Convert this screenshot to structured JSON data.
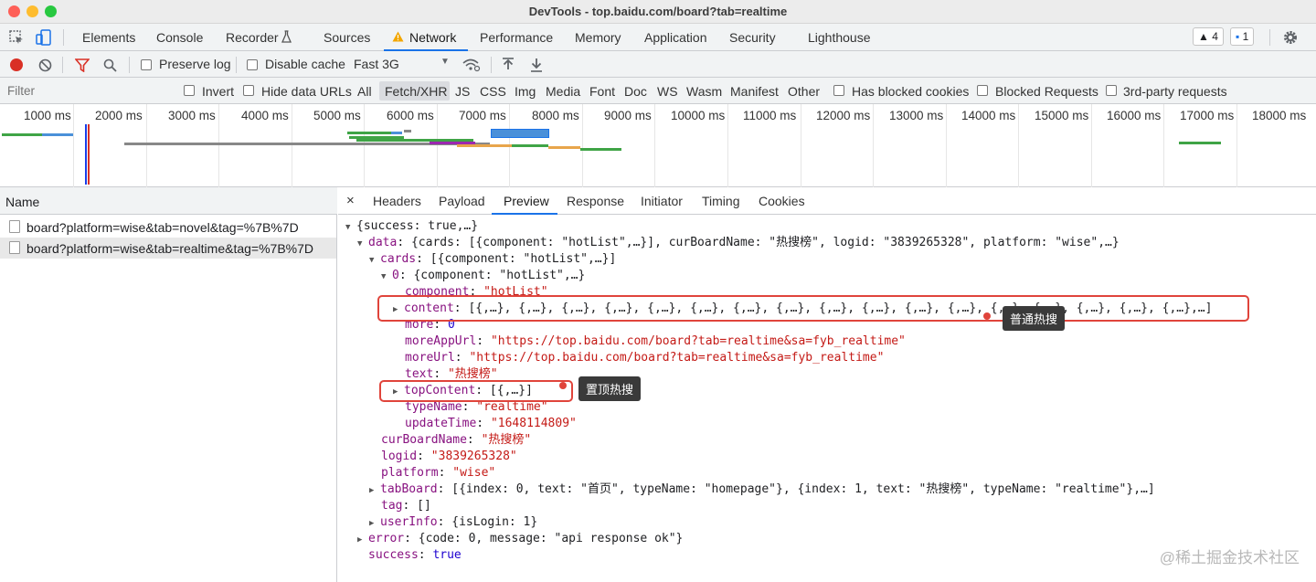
{
  "window": {
    "title": "DevTools - top.baidu.com/board?tab=realtime"
  },
  "main_tabs": [
    "Elements",
    "Console",
    "Recorder",
    "Sources",
    "Network",
    "Performance",
    "Memory",
    "Application",
    "Security",
    "Lighthouse"
  ],
  "badges": {
    "warnings": "4",
    "messages": "1"
  },
  "toolbar": {
    "preserve_log": "Preserve log",
    "disable_cache": "Disable cache",
    "throttle": "Fast 3G"
  },
  "filterbar": {
    "placeholder": "Filter",
    "invert": "Invert",
    "hide_data_urls": "Hide data URLs",
    "types": [
      "All",
      "Fetch/XHR",
      "JS",
      "CSS",
      "Img",
      "Media",
      "Font",
      "Doc",
      "WS",
      "Wasm",
      "Manifest",
      "Other"
    ],
    "selected_type": "Fetch/XHR",
    "blocked_cookies": "Has blocked cookies",
    "blocked_requests": "Blocked Requests",
    "third_party": "3rd-party requests"
  },
  "timeline": {
    "ticks": [
      "1000 ms",
      "2000 ms",
      "3000 ms",
      "4000 ms",
      "5000 ms",
      "6000 ms",
      "7000 ms",
      "8000 ms",
      "9000 ms",
      "10000 ms",
      "11000 ms",
      "12000 ms",
      "13000 ms",
      "14000 ms",
      "15000 ms",
      "16000 ms",
      "17000 ms",
      "18000 ms"
    ]
  },
  "requests": {
    "header": "Name",
    "items": [
      "board?platform=wise&tab=novel&tag=%7B%7D",
      "board?platform=wise&tab=realtime&tag=%7B%7D"
    ],
    "selected_index": 1
  },
  "detail_tabs": [
    "Headers",
    "Payload",
    "Preview",
    "Response",
    "Initiator",
    "Timing",
    "Cookies"
  ],
  "detail_close": "×",
  "preview": {
    "l1": "{success: true,…}",
    "l2_key": "data",
    "l2_val": ": {cards: [{component: \"hotList\",…}], curBoardName: \"热搜榜\", logid: \"3839265328\", platform: \"wise\",…}",
    "l3_key": "cards",
    "l3_val": ": [{component: \"hotList\",…}]",
    "l4_key": "0",
    "l4_val": ": {component: \"hotList\",…}",
    "l5_key": "component",
    "l5_val": "\"hotList\"",
    "l6_key": "content",
    "l6_val": ": [{,…}, {,…}, {,…}, {,…}, {,…}, {,…}, {,…}, {,…}, {,…}, {,…}, {,…}, {,…}, {,…}, {,…}, {,…}, {,…}, {,…},…]",
    "l7_key": "more",
    "l7_val": "0",
    "l8_key": "moreAppUrl",
    "l8_val": "\"https://top.baidu.com/board?tab=realtime&sa=fyb_realtime\"",
    "l9_key": "moreUrl",
    "l9_val": "\"https://top.baidu.com/board?tab=realtime&sa=fyb_realtime\"",
    "l10_key": "text",
    "l10_val": "\"热搜榜\"",
    "l11_key": "topContent",
    "l11_val": ": [{,…}]",
    "l12_key": "typeName",
    "l12_val": "\"realtime\"",
    "l13_key": "updateTime",
    "l13_val": "\"1648114809\"",
    "l14_key": "curBoardName",
    "l14_val": "\"热搜榜\"",
    "l15_key": "logid",
    "l15_val": "\"3839265328\"",
    "l16_key": "platform",
    "l16_val": "\"wise\"",
    "l17_key": "tabBoard",
    "l17_val": ": [{index: 0, text: \"首页\", typeName: \"homepage\"}, {index: 1, text: \"热搜榜\", typeName: \"realtime\"},…]",
    "l18_key": "tag",
    "l18_val": ": []",
    "l19_key": "userInfo",
    "l19_val": ": {isLogin: 1}",
    "l20_key": "error",
    "l20_val": ": {code: 0, message: \"api response ok\"}",
    "l21_key": "success",
    "l21_val": "true"
  },
  "annotations": {
    "content_tip": "普通热搜",
    "top_tip": "置顶热搜"
  },
  "watermark": "@稀土掘金技术社区",
  "colors": {
    "accent": "#1a73e8",
    "highlight": "#e0443b",
    "key": "#881280",
    "string": "#c41a16",
    "number": "#1c00cf"
  }
}
